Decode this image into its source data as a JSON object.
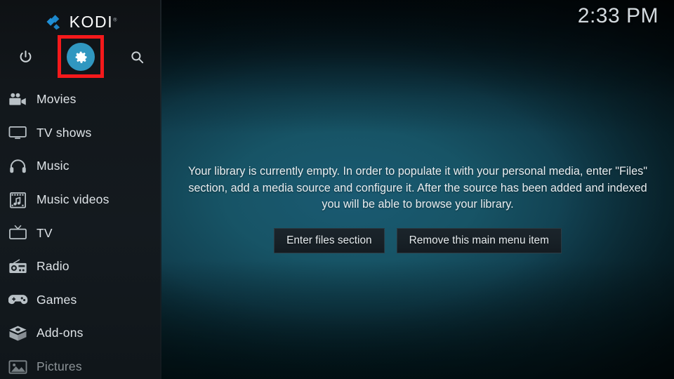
{
  "app": {
    "name": "KODI",
    "trademark": "®"
  },
  "clock": {
    "time": "2:33 PM"
  },
  "sidebar": {
    "top_icons": [
      {
        "name": "power-icon",
        "label": "Power"
      },
      {
        "name": "gear-icon",
        "label": "Settings"
      },
      {
        "name": "search-icon",
        "label": "Search"
      }
    ],
    "items": [
      {
        "label": "Movies",
        "icon": "movie-camera-icon",
        "dim": false
      },
      {
        "label": "TV shows",
        "icon": "television-icon",
        "dim": false
      },
      {
        "label": "Music",
        "icon": "headphones-icon",
        "dim": false
      },
      {
        "label": "Music videos",
        "icon": "film-music-icon",
        "dim": false
      },
      {
        "label": "TV",
        "icon": "tv-antenna-icon",
        "dim": false
      },
      {
        "label": "Radio",
        "icon": "radio-icon",
        "dim": false
      },
      {
        "label": "Games",
        "icon": "gamepad-icon",
        "dim": false
      },
      {
        "label": "Add-ons",
        "icon": "open-box-icon",
        "dim": false
      },
      {
        "label": "Pictures",
        "icon": "photo-icon",
        "dim": true
      }
    ]
  },
  "main": {
    "empty_message": "Your library is currently empty. In order to populate it with your personal media, enter \"Files\" section, add a media source and configure it. After the source has been added and indexed you will be able to browse your library.",
    "buttons": [
      {
        "label": "Enter files section"
      },
      {
        "label": "Remove this main menu item"
      }
    ]
  },
  "annotation": {
    "type": "highlight-rectangle",
    "target": "settings-gear-button",
    "color": "#f5191b"
  },
  "colors": {
    "accent_blue": "#3097c0",
    "logo_blue": "#1f8fd6",
    "sidebar_bg": "#12171b",
    "content_bg": "#175466",
    "highlight": "#f5191b"
  }
}
